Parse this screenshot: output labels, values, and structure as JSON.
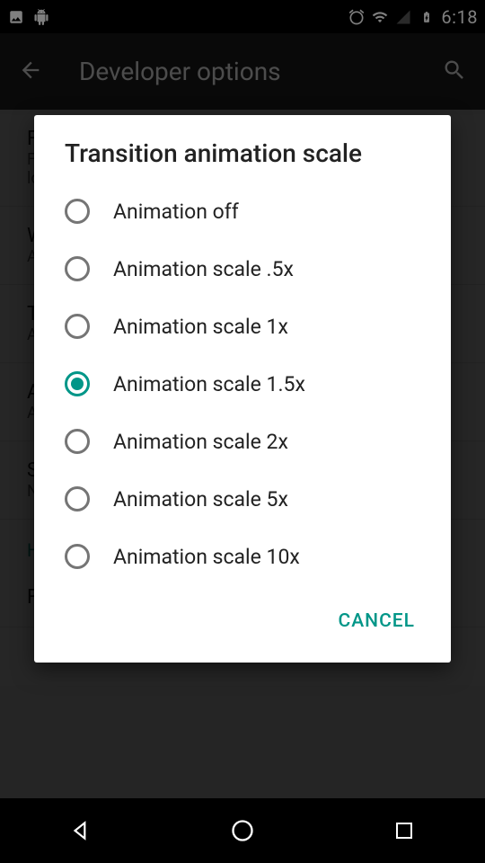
{
  "statusbar": {
    "time": "6:18"
  },
  "header": {
    "title": "Developer options"
  },
  "background": {
    "items": [
      {
        "label": "F",
        "sub": "F\nlo"
      },
      {
        "label": "W",
        "sub": "A"
      },
      {
        "label": "T",
        "sub": "A"
      },
      {
        "label": "A",
        "sub": "A"
      },
      {
        "label": "S",
        "sub": "N"
      }
    ],
    "section": "Hardware accelerated rendering",
    "last": "Force GPU rendering"
  },
  "dialog": {
    "title": "Transition animation scale",
    "options": [
      {
        "label": "Animation off",
        "selected": false
      },
      {
        "label": "Animation scale .5x",
        "selected": false
      },
      {
        "label": "Animation scale 1x",
        "selected": false
      },
      {
        "label": "Animation scale 1.5x",
        "selected": true
      },
      {
        "label": "Animation scale 2x",
        "selected": false
      },
      {
        "label": "Animation scale 5x",
        "selected": false
      },
      {
        "label": "Animation scale 10x",
        "selected": false
      }
    ],
    "cancel": "CANCEL"
  }
}
